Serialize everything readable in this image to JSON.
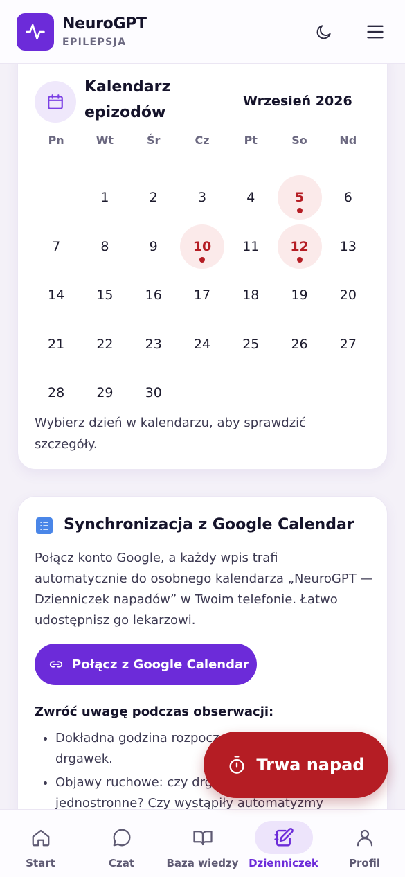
{
  "header": {
    "app_name": "NeuroGPT",
    "subtitle": "EPILEPSJA",
    "logo_icon": "pulse-icon",
    "theme_icon": "moon-icon",
    "menu_icon": "hamburger-menu-icon"
  },
  "calendar": {
    "title": "Kalendarz epizodów",
    "month_label": "Wrzesień 2026",
    "weekdays": [
      "Pn",
      "Wt",
      "Śr",
      "Cz",
      "Pt",
      "So",
      "Nd"
    ],
    "first_weekday_index": 1,
    "days_in_month": 30,
    "episode_days": [
      5,
      10,
      12
    ],
    "hint": "Wybierz dzień w kalendarzu, aby sprawdzić szczegóły."
  },
  "sync": {
    "title": "Synchronizacja z Google Calendar",
    "description": "Połącz konto Google, a każdy wpis trafi automatycznie do osobnego kalendarza „NeuroGPT — Dzienniczek napadów” w Twoim telefonie. Łatwo udostępnisz go lekarzowi.",
    "connect_label": "Połącz z Google Calendar",
    "notice_title": "Zwróć uwagę podczas obserwacji:",
    "notice_items": [
      "Dokładna godzina rozpoczęcia i zakończenia drgawek.",
      "Objawy ruchowe: czy drgawki były jednostronne? Czy wystąpiły automatyzmy (mlaskanie,"
    ]
  },
  "fab": {
    "label": "Trwa napad",
    "icon": "stopwatch-icon"
  },
  "nav": {
    "items": [
      {
        "label": "Start",
        "icon": "home-icon"
      },
      {
        "label": "Czat",
        "icon": "chat-bubble-icon"
      },
      {
        "label": "Baza wiedzy",
        "icon": "open-book-icon"
      },
      {
        "label": "Dzienniczek",
        "icon": "notebook-pen-icon",
        "active": true
      },
      {
        "label": "Profil",
        "icon": "user-icon"
      }
    ]
  },
  "colors": {
    "primary": "#6c2bd9",
    "danger": "#b51d24",
    "episode_bg": "#fbeaea"
  }
}
